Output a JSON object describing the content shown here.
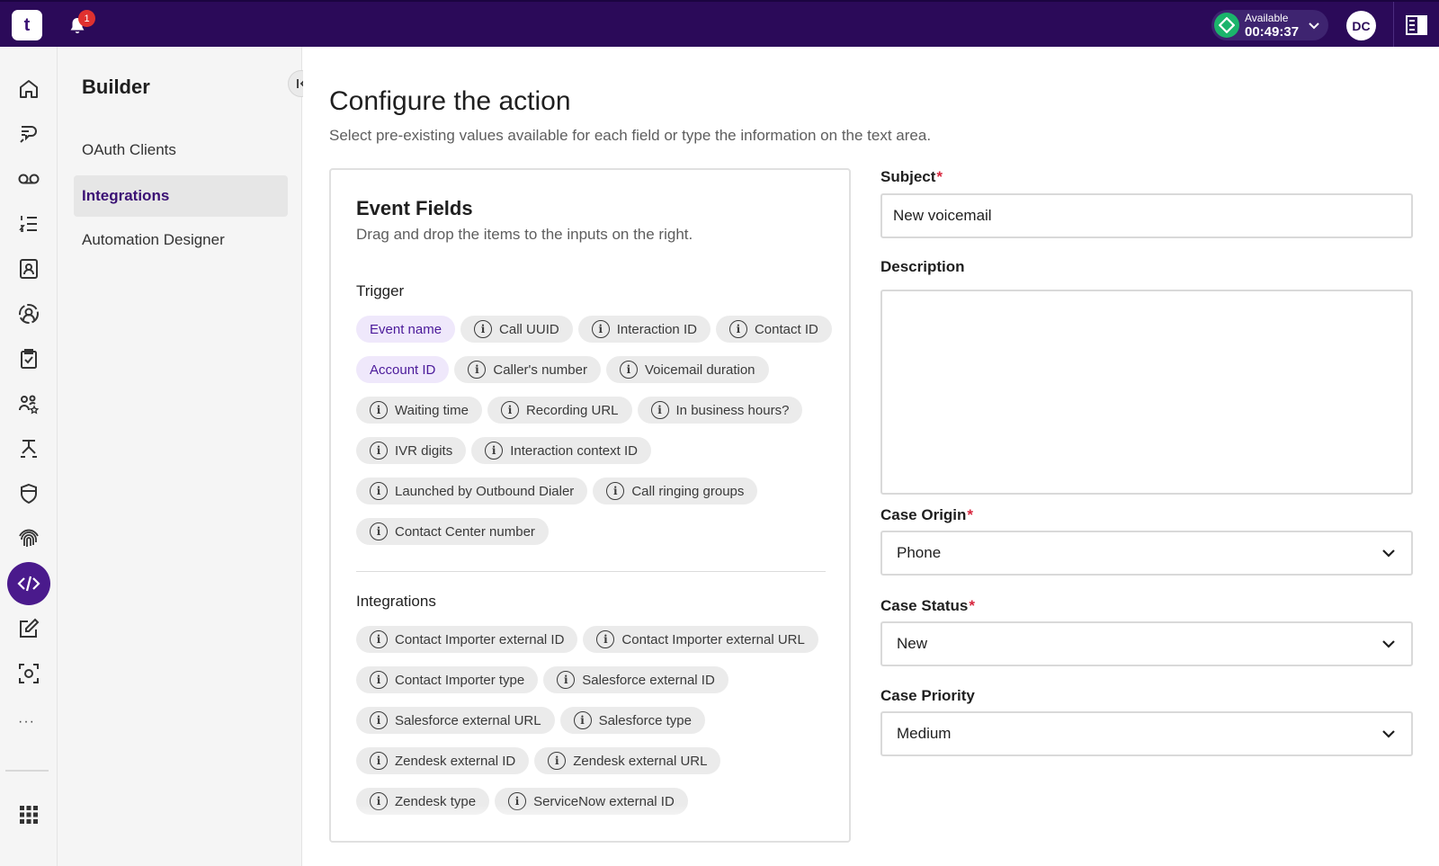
{
  "topbar": {
    "logo_text": "t",
    "notification_count": "1",
    "status_label": "Available",
    "status_timer": "00:49:37",
    "avatar_initials": "DC",
    "colors": {
      "bar": "#2b0a59",
      "status": "#1bb46b",
      "badge": "#e0312f"
    }
  },
  "rail": {
    "items": [
      "home-icon",
      "chat-bubble-icon",
      "voicemail-icon",
      "list-icon",
      "contacts-icon",
      "agent-icon",
      "clipboard-check-icon",
      "team-star-icon",
      "flow-icon",
      "shield-icon",
      "fingerprint-icon",
      "code-icon",
      "edit-icon",
      "scan-icon"
    ],
    "active": "code-icon",
    "more_label": "···"
  },
  "sidebar": {
    "title": "Builder",
    "items": [
      {
        "label": "OAuth Clients"
      },
      {
        "label": "Integrations",
        "active": true
      },
      {
        "label": "Automation Designer"
      }
    ]
  },
  "main": {
    "title": "Configure the action",
    "subtitle": "Select pre-existing values available for each field or type the information on the text area."
  },
  "event_fields": {
    "title": "Event Fields",
    "subtitle": "Drag and drop the items to the inputs on the right.",
    "trigger_label": "Trigger",
    "trigger_chips": [
      {
        "label": "Event name",
        "highlight": true
      },
      {
        "label": "Call UUID"
      },
      {
        "label": "Interaction ID"
      },
      {
        "label": "Contact ID"
      },
      {
        "label": "Account ID",
        "highlight": true
      },
      {
        "label": "Caller's number"
      },
      {
        "label": "Voicemail duration"
      },
      {
        "label": "Waiting time"
      },
      {
        "label": "Recording URL"
      },
      {
        "label": "In business hours?"
      },
      {
        "label": "IVR digits"
      },
      {
        "label": "Interaction context ID"
      },
      {
        "label": "Launched by Outbound Dialer"
      },
      {
        "label": "Call ringing groups"
      },
      {
        "label": "Contact Center number"
      }
    ],
    "integrations_label": "Integrations",
    "integration_chips": [
      {
        "label": "Contact Importer external ID"
      },
      {
        "label": "Contact Importer external URL"
      },
      {
        "label": "Contact Importer type"
      },
      {
        "label": "Salesforce external ID"
      },
      {
        "label": "Salesforce external URL"
      },
      {
        "label": "Salesforce type"
      },
      {
        "label": "Zendesk external ID"
      },
      {
        "label": "Zendesk external URL"
      },
      {
        "label": "Zendesk type"
      },
      {
        "label": "ServiceNow external ID"
      }
    ]
  },
  "form": {
    "subject_label": "Subject",
    "subject_value": "New voicemail",
    "description_label": "Description",
    "description_value": "",
    "case_origin_label": "Case Origin",
    "case_origin_value": "Phone",
    "case_status_label": "Case Status",
    "case_status_value": "New",
    "case_priority_label": "Case Priority",
    "case_priority_value": "Medium",
    "required_mark": "*"
  }
}
